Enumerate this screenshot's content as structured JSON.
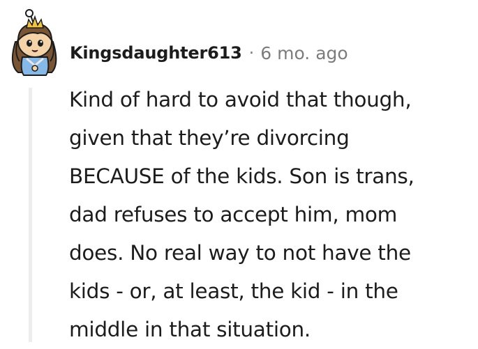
{
  "comment": {
    "author": "Kingsdaughter613",
    "separator": "·",
    "timestamp": "6 mo. ago",
    "avatar_icon": "snoo-avatar-crown-icon",
    "body_lines": [
      "Kind of hard to avoid that though,",
      "given that they’re divorcing",
      "BECAUSE of the kids. Son is trans,",
      "dad refuses to accept him, mom",
      "does. No real way to not have the",
      "kids - or, at least, the kid - in the",
      "middle in that situation."
    ]
  },
  "colors": {
    "text": "#1c1c1c",
    "meta": "#7c7c7c",
    "thread_line": "#ededed"
  }
}
